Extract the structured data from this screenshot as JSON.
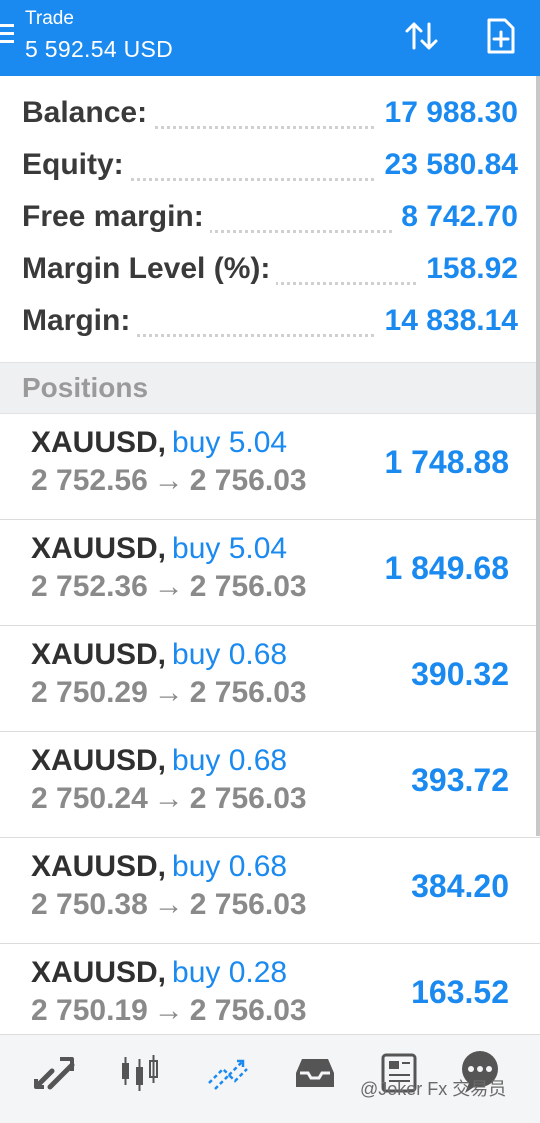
{
  "header": {
    "title": "Trade",
    "subtitle": "5 592.54 USD"
  },
  "account": {
    "rows": [
      {
        "label": "Balance:",
        "value": "17 988.30"
      },
      {
        "label": "Equity:",
        "value": "23 580.84"
      },
      {
        "label": "Free margin:",
        "value": "8 742.70"
      },
      {
        "label": "Margin Level (%):",
        "value": "158.92"
      },
      {
        "label": "Margin:",
        "value": "14 838.14"
      }
    ]
  },
  "positions_title": "Positions",
  "positions": [
    {
      "symbol": "XAUUSD,",
      "side": "buy 5.04",
      "open": "2 752.56",
      "arrow": "→",
      "current": "2 756.03",
      "profit": "1 748.88"
    },
    {
      "symbol": "XAUUSD,",
      "side": "buy 5.04",
      "open": "2 752.36",
      "arrow": "→",
      "current": "2 756.03",
      "profit": "1 849.68"
    },
    {
      "symbol": "XAUUSD,",
      "side": "buy 0.68",
      "open": "2 750.29",
      "arrow": "→",
      "current": "2 756.03",
      "profit": "390.32"
    },
    {
      "symbol": "XAUUSD,",
      "side": "buy 0.68",
      "open": "2 750.24",
      "arrow": "→",
      "current": "2 756.03",
      "profit": "393.72"
    },
    {
      "symbol": "XAUUSD,",
      "side": "buy 0.68",
      "open": "2 750.38",
      "arrow": "→",
      "current": "2 756.03",
      "profit": "384.20"
    },
    {
      "symbol": "XAUUSD,",
      "side": "buy 0.28",
      "open": "2 750.19",
      "arrow": "→",
      "current": "2 756.03",
      "profit": "163.52"
    }
  ],
  "nav": {
    "icons": [
      "quotes-icon",
      "chart-icon",
      "trade-icon",
      "history-icon",
      "news-icon",
      "chat-icon"
    ],
    "active": "trade-icon"
  },
  "watermark": "@Joker Fx 交易员",
  "colors": {
    "accent": "#1a8af0",
    "label": "#3a3a3a",
    "muted": "#8a8a8a"
  }
}
